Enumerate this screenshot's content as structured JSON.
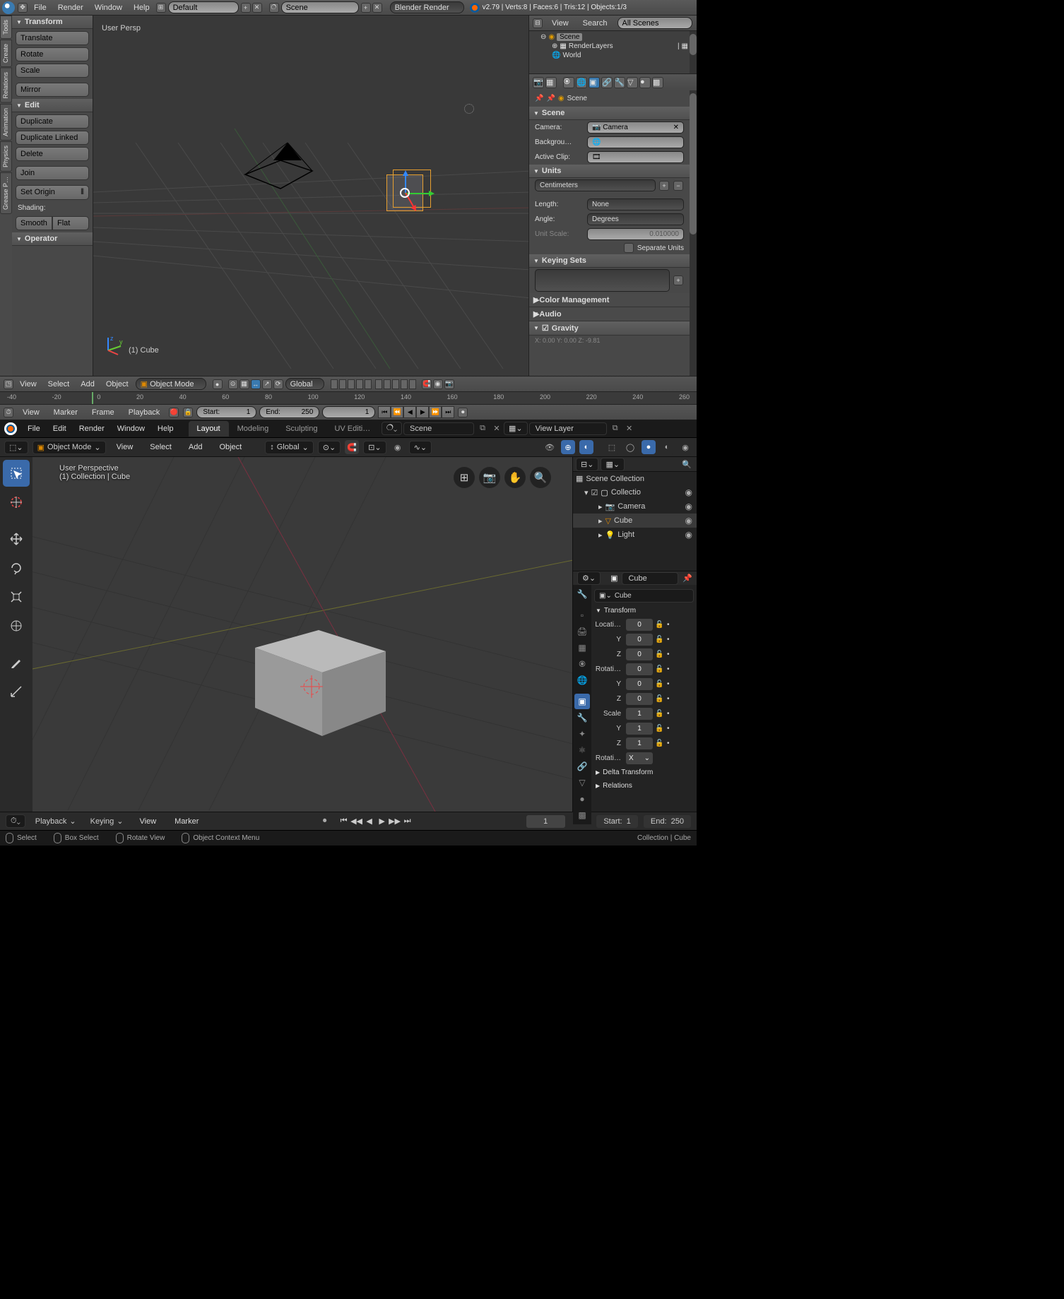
{
  "b279": {
    "top_menu": [
      "File",
      "Render",
      "Window",
      "Help"
    ],
    "layout": "Default",
    "scene": "Scene",
    "engine": "Blender Render",
    "stats": "v2.79 | Verts:8 | Faces:6 | Tris:12 | Objects:1/3",
    "vtabs": [
      "Tools",
      "Create",
      "Relations",
      "Animation",
      "Physics",
      "Grease P…"
    ],
    "panels": {
      "transform": {
        "title": "Transform",
        "btns": [
          "Translate",
          "Rotate",
          "Scale",
          "Mirror"
        ]
      },
      "edit": {
        "title": "Edit",
        "btns": [
          "Duplicate",
          "Duplicate Linked",
          "Delete",
          "Join",
          "Set Origin"
        ],
        "shading": "Shading:",
        "shade_btns": [
          "Smooth",
          "Flat"
        ]
      },
      "operator": "Operator"
    },
    "view": {
      "persp": "User Persp",
      "obj": "(1) Cube"
    },
    "footer_menu": [
      "View",
      "Select",
      "Add",
      "Object"
    ],
    "mode": "Object Mode",
    "orient": "Global",
    "outliner": {
      "hdr_menu": [
        "View",
        "Search"
      ],
      "filter": "All Scenes",
      "items": [
        "Scene",
        "RenderLayers",
        "World"
      ]
    },
    "props": {
      "bc_scene": "Scene",
      "scene_panel": "Scene",
      "camera_lbl": "Camera:",
      "camera": "Camera",
      "bg_lbl": "Backgrou…",
      "clip_lbl": "Active Clip:",
      "units_panel": "Units",
      "units": "Centimeters",
      "length_lbl": "Length:",
      "length": "None",
      "angle_lbl": "Angle:",
      "angle": "Degrees",
      "scale_lbl": "Unit Scale:",
      "scale": "0.010000",
      "sep": "Separate Units",
      "keying": "Keying Sets",
      "cm": "Color Management",
      "audio": "Audio",
      "grav": "Gravity",
      "loc": "X: 0.00       Y: 0.00       Z: -9.81"
    },
    "tl": {
      "menu": [
        "View",
        "Marker",
        "Frame",
        "Playback"
      ],
      "start_lbl": "Start:",
      "start": "1",
      "end_lbl": "End:",
      "end": "250",
      "cur": "1",
      "ticks": [
        "-40",
        "-20",
        "0",
        "20",
        "40",
        "60",
        "80",
        "100",
        "120",
        "140",
        "160",
        "180",
        "200",
        "220",
        "240",
        "260"
      ]
    }
  },
  "b28": {
    "top_menu": [
      "File",
      "Edit",
      "Render",
      "Window",
      "Help"
    ],
    "tabs": [
      "Layout",
      "Modeling",
      "Sculpting",
      "UV Editi…"
    ],
    "scene": "Scene",
    "viewlayer": "View Layer",
    "mode": "Object Mode",
    "hdr_menu": [
      "View",
      "Select",
      "Add",
      "Object"
    ],
    "orient": "Global",
    "persp": "User Perspective",
    "coll": "(1) Collection | Cube",
    "outliner": {
      "root": "Scene Collection",
      "coll": "Collectio",
      "items": [
        "Camera",
        "Cube",
        "Light"
      ]
    },
    "obj": "Cube",
    "transform_panel": "Transform",
    "loc": {
      "lbl": "Locati…",
      "x": "0",
      "y": "0",
      "z": "0"
    },
    "rot": {
      "lbl": "Rotati…",
      "x": "0",
      "y": "0",
      "z": "0"
    },
    "scl": {
      "lbl": "Scale",
      "x": "1",
      "y": "1",
      "z": "1"
    },
    "rotmode": {
      "lbl": "Rotati…",
      "v": "X"
    },
    "delta": "Delta Transform",
    "rel": "Relations",
    "tl": {
      "playback": "Playback",
      "keying": "Keying",
      "view": "View",
      "marker": "Marker",
      "cur": "1",
      "start_lbl": "Start:",
      "start": "1",
      "end_lbl": "End:",
      "end": "250"
    },
    "status": {
      "select": "Select",
      "box": "Box Select",
      "rotate": "Rotate View",
      "ctx": "Object Context Menu",
      "path": "Collection | Cube"
    }
  }
}
